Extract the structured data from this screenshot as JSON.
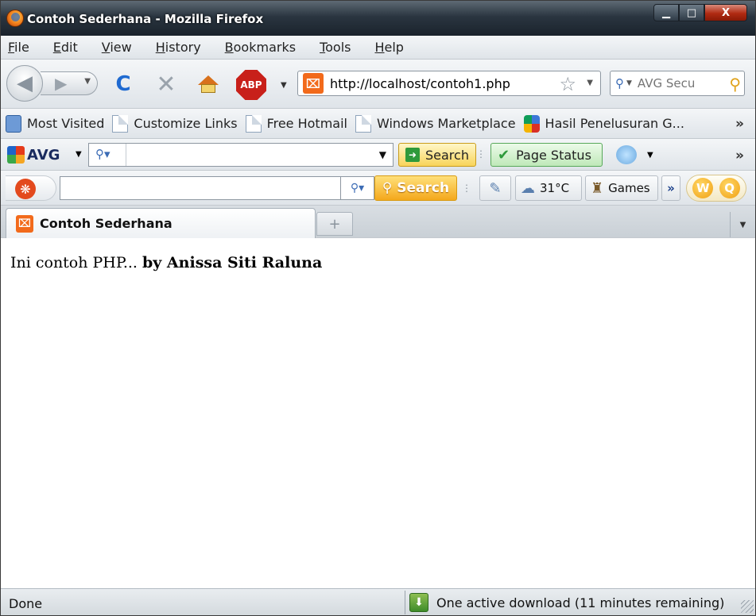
{
  "window": {
    "title": "Contoh Sederhana - Mozilla Firefox",
    "controls": {
      "minimize": "▁",
      "maximize": "□",
      "close": "X"
    }
  },
  "menu": [
    "File",
    "Edit",
    "View",
    "History",
    "Bookmarks",
    "Tools",
    "Help"
  ],
  "nav": {
    "back_icon": "◀",
    "forward_icon": "▶",
    "reload_icon": "C",
    "stop_icon": "✕",
    "abp_label": "ABP",
    "site_icon_glyph": "⌧",
    "url": "http://localhost/contoh1.php",
    "search_placeholder": "AVG Secu"
  },
  "bookmarks": [
    "Most Visited",
    "Customize Links",
    "Free Hotmail",
    "Windows Marketplace",
    "Hasil Penelusuran G..."
  ],
  "avg_toolbar": {
    "logo": "AVG",
    "search_button": "Search",
    "page_status_button": "Page Status"
  },
  "ext_toolbar": {
    "logo_glyph": "❋",
    "search_button": "Search",
    "weather_temp": "31°C",
    "games_label": "Games",
    "more_glyph": "»",
    "w_glyph": "W",
    "q_glyph": "Q"
  },
  "tabs": [
    {
      "label": "Contoh Sederhana",
      "icon_glyph": "⌧"
    }
  ],
  "newtab_glyph": "+",
  "content": {
    "intro": "Ini contoh PHP... ",
    "author": "by Anissa Siti Raluna"
  },
  "status": {
    "text": "Done",
    "download": "One active download (11 minutes remaining)",
    "download_glyph": "⬇"
  },
  "colors": {
    "accent_reload": "#1f6ad1",
    "abp_red": "#c8201a",
    "site_icon_orange": "#f26a1b",
    "avg_search_yellow": "#f8d45a",
    "page_status_green": "#bfe8b9"
  }
}
